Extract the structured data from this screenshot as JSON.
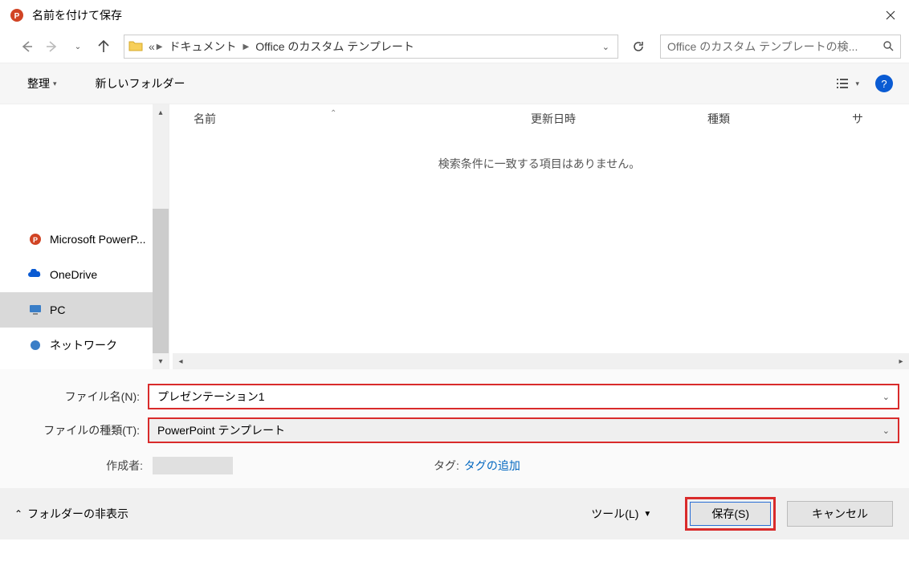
{
  "window": {
    "title": "名前を付けて保存"
  },
  "path": {
    "overflow": "«",
    "seg1": "ドキュメント",
    "seg2": "Office のカスタム テンプレート"
  },
  "search": {
    "placeholder": "Office のカスタム テンプレートの検..."
  },
  "toolbar": {
    "organize": "整理",
    "new_folder": "新しいフォルダー"
  },
  "columns": {
    "name": "名前",
    "date": "更新日時",
    "type": "種類",
    "size": "サ"
  },
  "listing": {
    "empty": "検索条件に一致する項目はありません。"
  },
  "sidebar": {
    "powerpoint": "Microsoft PowerP...",
    "onedrive": "OneDrive",
    "pc": "PC",
    "network": "ネットワーク"
  },
  "form": {
    "filename_label": "ファイル名(N):",
    "filename_value": "プレゼンテーション1",
    "filetype_label": "ファイルの種類(T):",
    "filetype_value": "PowerPoint テンプレート",
    "author_label": "作成者:",
    "tag_label": "タグ:",
    "tag_add": "タグの追加"
  },
  "footer": {
    "hide_folders": "フォルダーの非表示",
    "tools": "ツール(L)",
    "save": "保存(S)",
    "cancel": "キャンセル"
  }
}
